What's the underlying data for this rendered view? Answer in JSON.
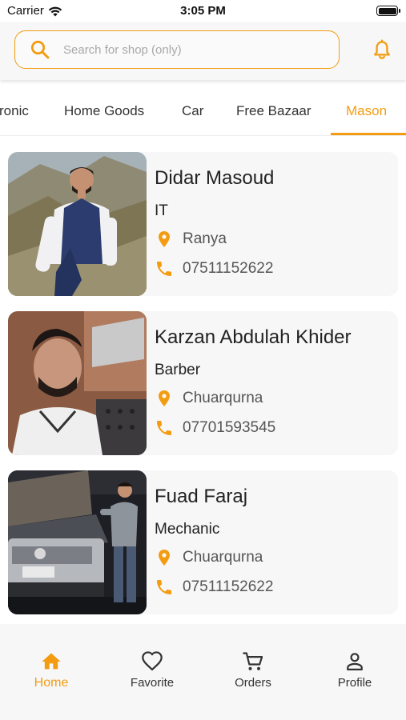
{
  "status_bar": {
    "carrier": "Carrier",
    "time": "3:05 PM"
  },
  "header": {
    "search_placeholder": "Search for shop (only)",
    "search_value": ""
  },
  "colors": {
    "accent": "#f39c12",
    "card_background": "#f7f7f7",
    "text_primary": "#222222",
    "text_secondary": "#555555"
  },
  "tabs": [
    {
      "label": "ronic",
      "active": false
    },
    {
      "label": "Home Goods",
      "active": false
    },
    {
      "label": "Car",
      "active": false
    },
    {
      "label": "Free Bazaar",
      "active": false
    },
    {
      "label": "Mason",
      "active": true
    }
  ],
  "shops": [
    {
      "name": "Didar Masoud",
      "profession": "IT",
      "location": "Ranya",
      "phone": "07511152622",
      "photo": "portrait-man-mountains"
    },
    {
      "name": "Karzan Abdulah Khider",
      "profession": "Barber",
      "location": "Chuarqurna",
      "phone": "07701593545",
      "photo": "portrait-barber-salon"
    },
    {
      "name": "Fuad Faraj",
      "profession": "Mechanic",
      "location": "Chuarqurna",
      "phone": "07511152622",
      "photo": "mechanic-with-car"
    }
  ],
  "bottom_nav": [
    {
      "label": "Home",
      "icon": "home-icon",
      "active": true
    },
    {
      "label": "Favorite",
      "icon": "heart-icon",
      "active": false
    },
    {
      "label": "Orders",
      "icon": "cart-icon",
      "active": false
    },
    {
      "label": "Profile",
      "icon": "person-icon",
      "active": false
    }
  ]
}
